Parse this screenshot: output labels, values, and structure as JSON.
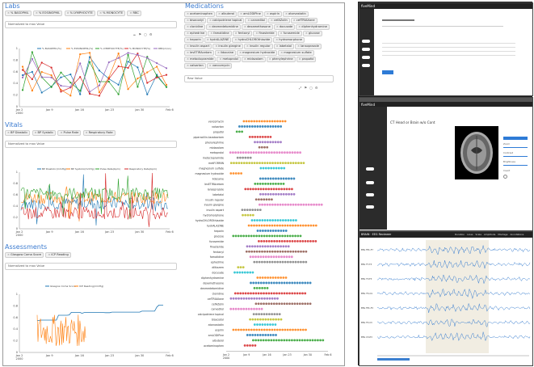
{
  "left": {
    "labs": {
      "title": "Labs",
      "tags": [
        "% BASOPHIL",
        "% EOSINOPHIL",
        "% LYMPHOCYTE",
        "% MONOCYTE",
        "RBC"
      ],
      "normalize_label": "Normalized to max Value",
      "toolbar": "⤠ ⚑ ◻ ⚙",
      "legend": [
        "% BASOPHIL(%)",
        "% EOSINOPHIL(%)",
        "% LYMPHOCYTE(%)",
        "% MONOCYTE(%)",
        "RBC(m/uL)"
      ],
      "x_ticks": [
        "Jan 2\n2000",
        "Jan 9",
        "Jan 16",
        "Jan 23",
        "Jan 30",
        "Feb 6"
      ],
      "y_ticks": [
        "0",
        "0.2",
        "0.4",
        "0.6",
        "0.8",
        "1"
      ]
    },
    "vitals": {
      "title": "Vitals",
      "tags": [
        "BP Diastolic",
        "BP Systolic",
        "Pulse Rate",
        "Respiratory Rate"
      ],
      "normalize_label": "Normalized to max Value",
      "legend": [
        "BP Diastolic(mmHg)",
        "BP Systolic(mmHg)",
        "Pulse Rate(bpm)",
        "Respiratory Rate(bpm)"
      ],
      "x_ticks": [
        "Jan 2\n2000",
        "Jan 9",
        "Jan 16",
        "Jan 23",
        "Jan 30",
        "Feb 6"
      ],
      "y_ticks": [
        "0",
        "0.2",
        "0.4",
        "0.6",
        "0.8",
        "1"
      ]
    },
    "assessments": {
      "title": "Assessments",
      "tags": [
        "Glasgow Coma Score",
        "ICP Reading"
      ],
      "normalize_label": "Normalized to max Value",
      "legend": [
        "Glasgow Coma Score",
        "ICP Reading(mmHg)"
      ],
      "x_ticks": [
        "Jan 2\n2000",
        "Jan 9",
        "Jan 16",
        "Jan 23",
        "Jan 30",
        "Feb 6"
      ],
      "y_ticks": [
        "0",
        "0.2",
        "0.4",
        "0.6",
        "0.8",
        "1"
      ]
    }
  },
  "medications": {
    "title": "Medications",
    "tags": [
      "acetaminophen",
      "albuterol",
      "amLODIPine",
      "aspirin",
      "atorvastatin",
      "bisacodyl",
      "calcipotriene topical",
      "carvedilol",
      "cefAZolin",
      "cefTRIAXone",
      "clonidine",
      "dexmedetomidine",
      "dexamethasone",
      "docusate",
      "diphenhydramine",
      "ephedrine",
      "famotidine",
      "fentanyl",
      "finasteride",
      "furosemide",
      "glucose",
      "heparin",
      "hydrALAZINE",
      "hydroCHLOROthiazide",
      "hydromorphone",
      "insulin aspart",
      "insulin glargine",
      "insulin regular",
      "labetalol",
      "lansoprazole",
      "levETIRAcetam",
      "lidocaine",
      "magnesium hydroxide",
      "magnesium sulfate",
      "metoclopramide",
      "metoprolol",
      "midazolam",
      "phenylephrine",
      "propofol",
      "valsartan",
      "vancomycin"
    ],
    "raw_label": "Raw Value",
    "drugs": [
      "vancomycin",
      "valsartan",
      "propofol",
      "piperacillin-tazobactam",
      "phenylephrine",
      "midazolam",
      "metoprolol",
      "metoclopramide",
      "metFORMIN",
      "magnesium sulfate",
      "magnesium hydroxide",
      "lidocaine",
      "levETIRAcetam",
      "lansoprazole",
      "labetalol",
      "insulin regular",
      "insulin glargine",
      "insulin aspart",
      "hydromorphone",
      "hydroCHLOROthiazide",
      "hydrALAZINE",
      "heparin",
      "glucose",
      "furosemide",
      "finasteride",
      "fentanyl",
      "famotidine",
      "ephedrine",
      "diltiazem",
      "docusate",
      "diphenhydramine",
      "dexamethasone",
      "dexmedetomidine",
      "clonidine",
      "cefTRIAXone",
      "cefAZolin",
      "carvedilol",
      "calcipotriene topical",
      "bisacodyl",
      "atorvastatin",
      "aspirin",
      "amLODIPine",
      "albuterol",
      "acetaminophen"
    ],
    "x_ticks": [
      "Jan 2\n2000",
      "Jan 9",
      "Jan 16",
      "Jan 23",
      "Jan 30",
      "Feb 6"
    ]
  },
  "right": {
    "brand": "fiveMind",
    "viewer_title": "CT Head or Brain w/o Cont",
    "eeg_title": "BRAIN · EEG Reviewer",
    "eeg_tabs": [
      "Duration",
      "Lines",
      "Scale",
      "Amplitude",
      "Montage",
      "Annotations"
    ],
    "eeg_channels": [
      "EEG FP1-F7",
      "EEG F7-T3",
      "EEG T3-T5",
      "EEG T5-O1",
      "EEG FP1-F3",
      "EEG F3-C3",
      "EEG C3-P3"
    ],
    "viewer_controls": [
      "Zoom",
      "Contrast",
      "Brightness",
      "Invert"
    ]
  },
  "colors": {
    "blue": "#1f77b4",
    "orange": "#ff7f0e",
    "green": "#2ca02c",
    "red": "#d62728",
    "purple": "#9467bd",
    "pink": "#e377c2",
    "cyan": "#17becf",
    "olive": "#bcbd22",
    "brown": "#8c564b",
    "gray": "#7f7f7f"
  }
}
